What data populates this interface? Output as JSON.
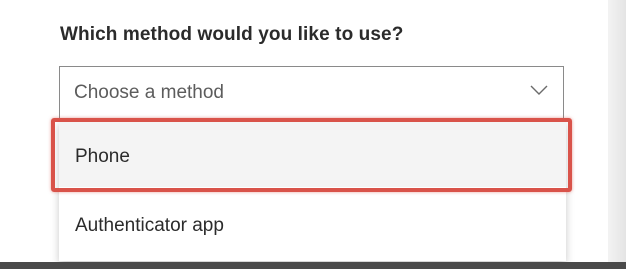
{
  "form": {
    "question": "Which method would you like to use?",
    "select": {
      "placeholder": "Choose a method",
      "icon": "chevron-down-icon"
    },
    "options": [
      {
        "label": "Phone",
        "highlighted": true
      },
      {
        "label": "Authenticator app",
        "highlighted": false
      }
    ]
  },
  "colors": {
    "highlight_border": "#d9534a",
    "text": "#2b2b2b",
    "placeholder_text": "#5c5c5c",
    "select_border": "#8a8a8a",
    "hovered_option_bg": "#f4f4f4"
  }
}
